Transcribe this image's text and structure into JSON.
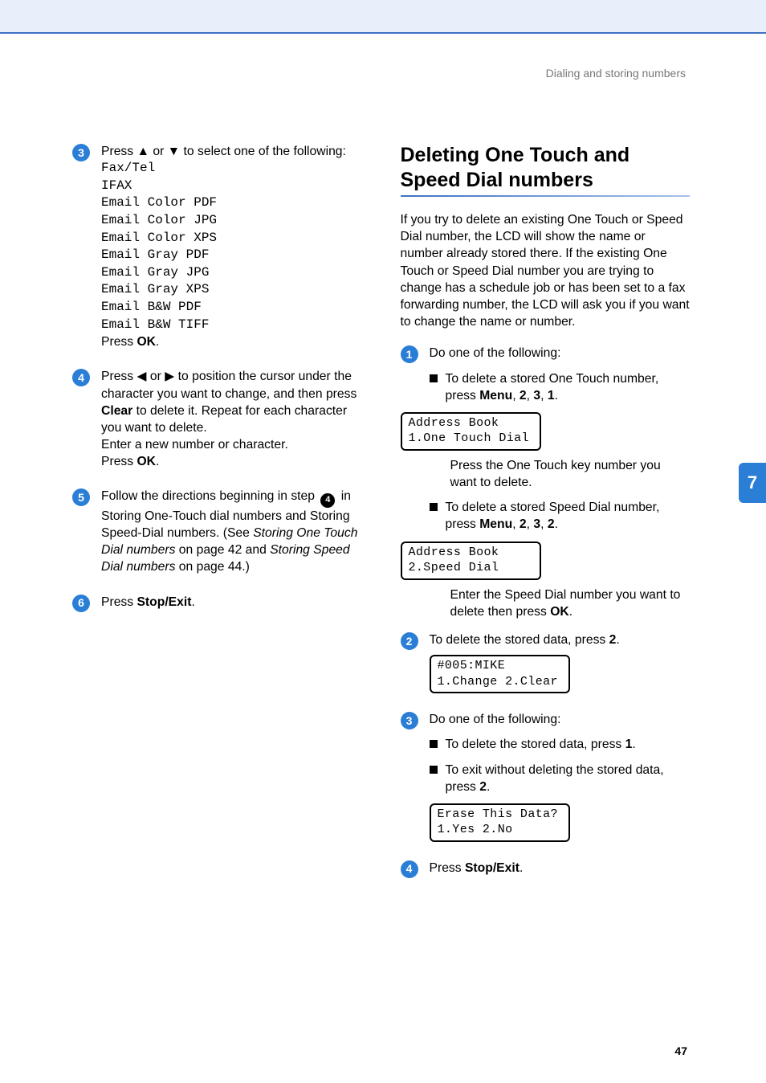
{
  "header": {
    "section_title": "Dialing and storing numbers"
  },
  "left": {
    "step3": {
      "num": "3",
      "intro": "Press a or b to select one of the following:",
      "options": [
        "Fax/Tel",
        "IFAX",
        "Email Color PDF",
        "Email Color JPG",
        "Email Color XPS",
        "Email Gray PDF",
        "Email Gray JPG",
        "Email Gray XPS",
        "Email B&W PDF",
        "Email B&W TIFF"
      ],
      "press_ok_pre": "Press ",
      "press_ok_bold": "OK",
      "press_ok_post": "."
    },
    "step4": {
      "num": "4",
      "line1a": "Press d or c to position the cursor under the character you want to change, and then press ",
      "clear": "Clear",
      "line1b": " to delete it. Repeat for each character you want to delete.",
      "line2": "Enter a new number or character.",
      "line3a": "Press ",
      "line3b": "OK",
      "line3c": "."
    },
    "step5": {
      "num": "5",
      "pre": "Follow the directions beginning in step ",
      "small": "4",
      "mid": " in Storing One-Touch dial numbers and Storing Speed-Dial numbers. (See ",
      "it1": "Storing One Touch Dial numbers",
      "mid2": " on page 42 and ",
      "it2": "Storing Speed Dial numbers",
      "end": " on page 44.)"
    },
    "step6": {
      "num": "6",
      "pre": "Press ",
      "bold": "Stop/Exit",
      "post": "."
    }
  },
  "right": {
    "heading": "Deleting One Touch and Speed Dial numbers",
    "para": "If you try to delete an existing One Touch or Speed Dial number, the LCD will show the name or number already stored there. If the existing One Touch or Speed Dial number you are trying to change has a schedule job or has been set to a fax forwarding number, the LCD will ask you if you want to change the name or number.",
    "step1": {
      "num": "1",
      "intro": "Do one of the following:",
      "b1a": "To delete a stored One Touch number, press ",
      "menu": "Menu",
      "comma_231": ", ",
      "k2": "2",
      "k3": "3",
      "k1": "1",
      "period": ".",
      "lcd1_l1": "Address Book",
      "lcd1_l2": "1.One Touch Dial",
      "b1c": "Press the One Touch key number you want to delete.",
      "b2a": "To delete a stored Speed Dial number, press ",
      "b2_k3b": "2",
      "lcd2_l1": "Address Book",
      "lcd2_l2": "2.Speed Dial",
      "b2c_pre": "Enter the Speed Dial number you want to delete then press ",
      "ok": "OK",
      "b2c_post": "."
    },
    "step2": {
      "num": "2",
      "pre": "To delete the stored data, press ",
      "key": "2",
      "post": ".",
      "lcd_l1": "#005:MIKE",
      "lcd_l2": "1.Change 2.Clear"
    },
    "step3": {
      "num": "3",
      "intro": "Do one of the following:",
      "b1_pre": "To delete the stored data, press ",
      "b1_key": "1",
      "b1_post": ".",
      "b2_pre": "To exit without deleting the stored data, press ",
      "b2_key": "2",
      "b2_post": ".",
      "lcd_l1": "Erase This Data?",
      "lcd_l2": "1.Yes 2.No"
    },
    "step4": {
      "num": "4",
      "pre": "Press ",
      "bold": "Stop/Exit",
      "post": "."
    }
  },
  "side_tab": "7",
  "footer_page": "47"
}
